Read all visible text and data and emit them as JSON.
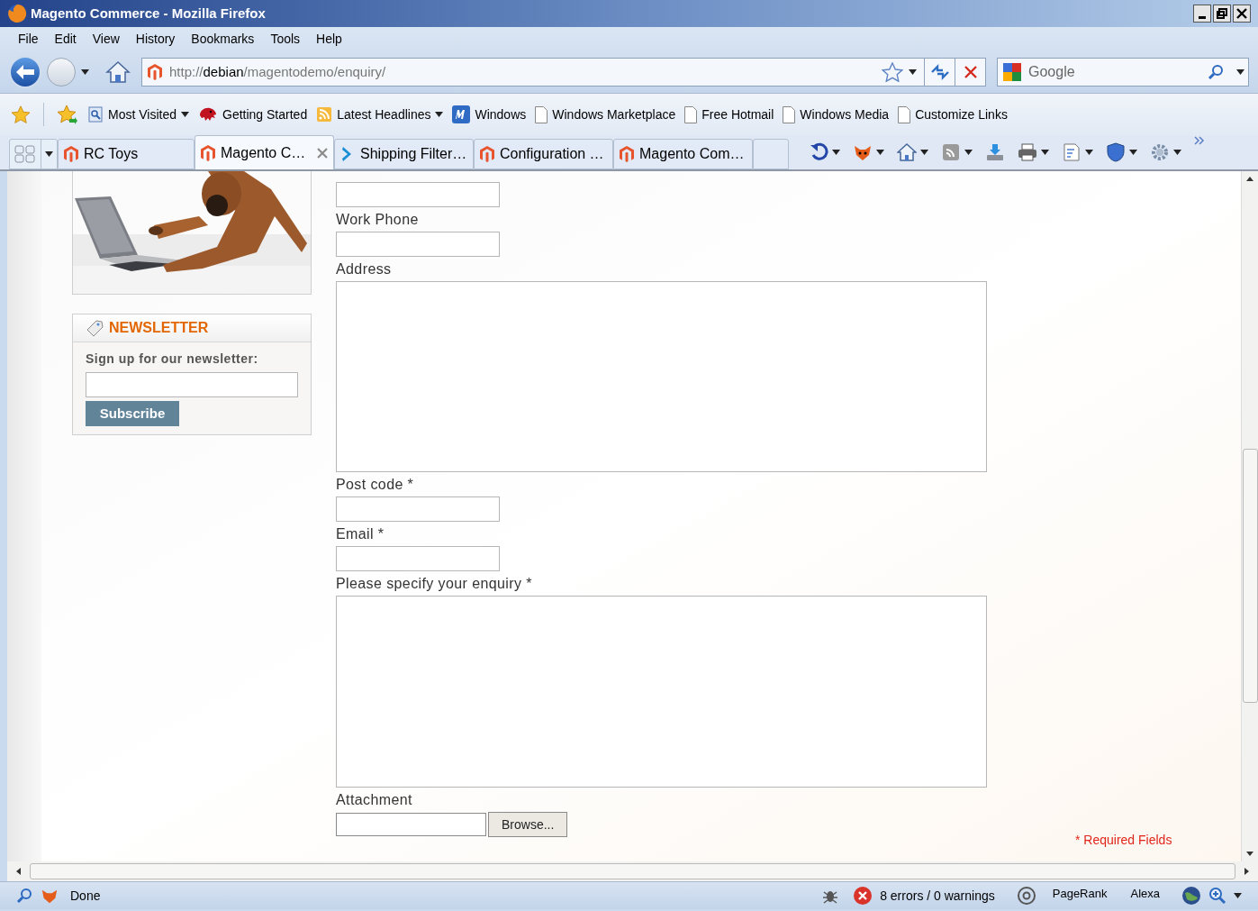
{
  "window": {
    "title": "Magento Commerce - Mozilla Firefox"
  },
  "menu": [
    {
      "label": "File"
    },
    {
      "label": "Edit"
    },
    {
      "label": "View"
    },
    {
      "label": "History"
    },
    {
      "label": "Bookmarks"
    },
    {
      "label": "Tools"
    },
    {
      "label": "Help"
    }
  ],
  "address_bar": {
    "scheme": "http://",
    "host": "debian",
    "path": "/magentodemo/enquiry/"
  },
  "search": {
    "placeholder": "Google"
  },
  "bookmarks": [
    {
      "label": "Most Visited",
      "kind": "folder",
      "dropdown": true
    },
    {
      "label": "Getting Started",
      "kind": "site",
      "dropdown": false
    },
    {
      "label": "Latest Headlines",
      "kind": "feed",
      "dropdown": true
    },
    {
      "label": "Windows",
      "kind": "brand",
      "dropdown": false
    },
    {
      "label": "Windows Marketplace",
      "kind": "page",
      "dropdown": false
    },
    {
      "label": "Free Hotmail",
      "kind": "page",
      "dropdown": false
    },
    {
      "label": "Windows Media",
      "kind": "page",
      "dropdown": false
    },
    {
      "label": "Customize Links",
      "kind": "page",
      "dropdown": false
    }
  ],
  "tabs": [
    {
      "label": "RC Toys",
      "kind": "magento",
      "selected": false
    },
    {
      "label": "Magento C…",
      "kind": "magento",
      "selected": true
    },
    {
      "label": "Shipping Filter…",
      "kind": "arrow",
      "selected": false
    },
    {
      "label": "Configuration …",
      "kind": "magento",
      "selected": false
    },
    {
      "label": "Magento Com…",
      "kind": "magento",
      "selected": false
    }
  ],
  "sidebar": {
    "newsletter": {
      "title": "NEWSLETTER",
      "label": "Sign up for our newsletter:",
      "button": "Subscribe"
    }
  },
  "form": {
    "fields": [
      {
        "kind": "input"
      },
      {
        "label": "Work Phone",
        "kind": "input"
      },
      {
        "label": "Address",
        "kind": "textarea"
      },
      {
        "label": "Post code *",
        "kind": "input"
      },
      {
        "label": "Email *",
        "kind": "input"
      },
      {
        "label": "Please specify your enquiry *",
        "kind": "textarea"
      },
      {
        "label": "Attachment",
        "kind": "file",
        "button": "Browse..."
      }
    ],
    "required_note": "* Required Fields"
  },
  "status_bar": {
    "text": "Done",
    "errors": "8 errors / 0 warnings",
    "pagerank": "PageRank",
    "alexa": "Alexa"
  }
}
